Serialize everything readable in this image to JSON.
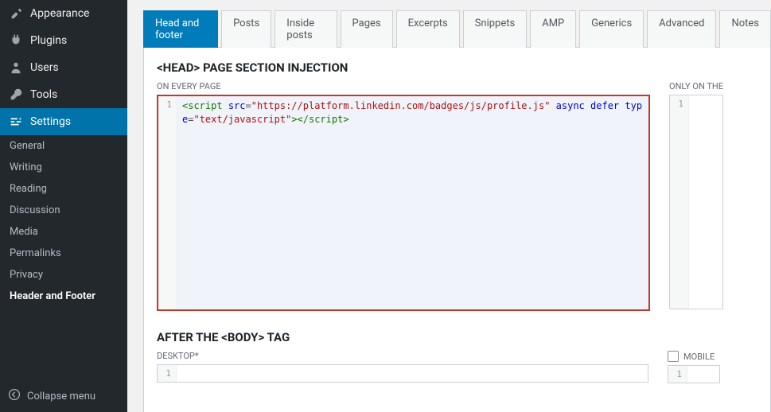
{
  "sidebar": {
    "items": [
      {
        "label": "Appearance",
        "icon": "brush"
      },
      {
        "label": "Plugins",
        "icon": "plug"
      },
      {
        "label": "Users",
        "icon": "user"
      },
      {
        "label": "Tools",
        "icon": "wrench"
      },
      {
        "label": "Settings",
        "icon": "sliders"
      }
    ],
    "sub_items": [
      "General",
      "Writing",
      "Reading",
      "Discussion",
      "Media",
      "Permalinks",
      "Privacy",
      "Header and Footer"
    ],
    "collapse": "Collapse menu"
  },
  "tabs": [
    "Head and footer",
    "Posts",
    "Inside posts",
    "Pages",
    "Excerpts",
    "Snippets",
    "AMP",
    "Generics",
    "Advanced",
    "Notes"
  ],
  "section1": {
    "title": "<HEAD> PAGE SECTION INJECTION",
    "label_left": "ON EVERY PAGE",
    "label_right": "ONLY ON THE",
    "line_no": "1",
    "code_tokens": {
      "open_tag": "<script",
      "sp": " ",
      "attr_src": "src",
      "eq": "=",
      "str_src": "\"https://platform.linkedin.com/badges/js/profile.js\"",
      "attr_async": "async",
      "attr_defer": "defer",
      "attr_type": "type",
      "str_type": "\"text/javascript\"",
      "close_open": ">",
      "close_tag": "</script>"
    }
  },
  "section2": {
    "title": "AFTER THE <BODY> TAG",
    "label_left": "DESKTOP*",
    "label_right": "MOBILE",
    "line_no": "1"
  }
}
